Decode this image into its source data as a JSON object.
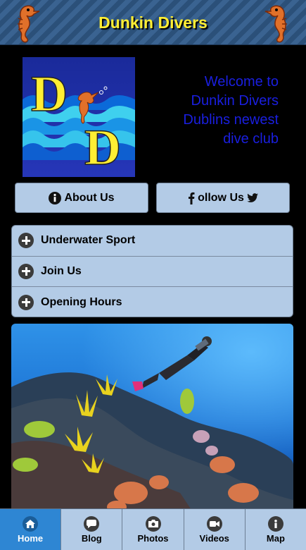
{
  "header": {
    "title": "Dunkin Divers"
  },
  "hero": {
    "welcome_lines": [
      "Welcome to",
      "Dunkin Divers",
      "Dublins newest",
      "dive club"
    ],
    "logo_letters": [
      "D",
      "D"
    ]
  },
  "buttons": {
    "about_label": "About Us",
    "follow_label": "ollow Us"
  },
  "accordion": {
    "items": [
      {
        "label": "Underwater Sport"
      },
      {
        "label": "Join Us"
      },
      {
        "label": "Opening Hours"
      }
    ]
  },
  "navbar": {
    "items": [
      {
        "label": "Home",
        "icon": "home-icon",
        "active": true
      },
      {
        "label": "Blog",
        "icon": "comment-icon",
        "active": false
      },
      {
        "label": "Photos",
        "icon": "camera-icon",
        "active": false
      },
      {
        "label": "Videos",
        "icon": "video-icon",
        "active": false
      },
      {
        "label": "Map",
        "icon": "info-icon",
        "active": false
      }
    ]
  },
  "colors": {
    "header_title": "#ffee33",
    "welcome_text": "#1a1fe0",
    "button_bg": "#b3cbe6",
    "nav_active": "#2e86d3"
  }
}
